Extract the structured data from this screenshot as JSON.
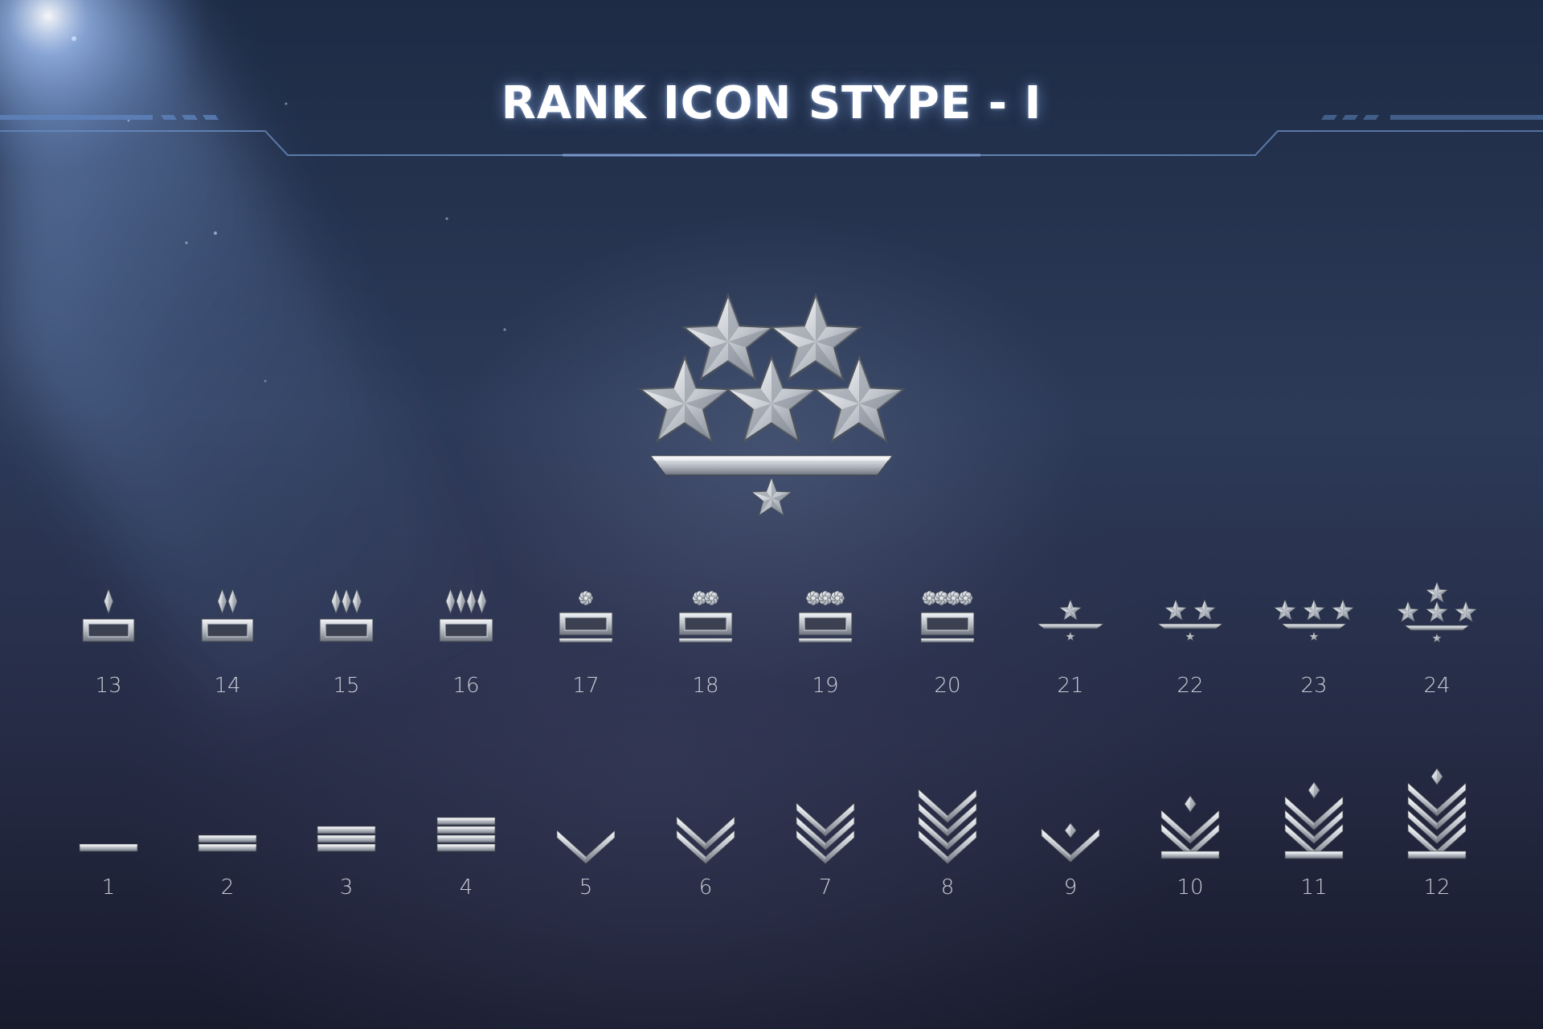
{
  "title": "RANK ICON STYPE - I",
  "colors": {
    "metal_light": "#f4f6f8",
    "metal_mid": "#b9bec6",
    "metal_dark": "#6f7580",
    "label": "#c9cdd6"
  },
  "hero": {
    "icon": "five-star-general-icon"
  },
  "top_row": [
    {
      "label": "13",
      "icon": "diamond-bar-1-icon"
    },
    {
      "label": "14",
      "icon": "diamond-bar-2-icon"
    },
    {
      "label": "15",
      "icon": "diamond-bar-3-icon"
    },
    {
      "label": "16",
      "icon": "diamond-bar-4-icon"
    },
    {
      "label": "17",
      "icon": "flower-bar-1-icon"
    },
    {
      "label": "18",
      "icon": "flower-bar-2-icon"
    },
    {
      "label": "19",
      "icon": "flower-bar-3-icon"
    },
    {
      "label": "20",
      "icon": "flower-bar-4-icon"
    },
    {
      "label": "21",
      "icon": "star-1-icon"
    },
    {
      "label": "22",
      "icon": "star-2-icon"
    },
    {
      "label": "23",
      "icon": "star-3-icon"
    },
    {
      "label": "24",
      "icon": "star-4-icon"
    }
  ],
  "bottom_row": [
    {
      "label": "1",
      "icon": "stripe-1-icon"
    },
    {
      "label": "2",
      "icon": "stripe-2-icon"
    },
    {
      "label": "3",
      "icon": "stripe-3-icon"
    },
    {
      "label": "4",
      "icon": "stripe-4-icon"
    },
    {
      "label": "5",
      "icon": "chevron-1-icon"
    },
    {
      "label": "6",
      "icon": "chevron-2-icon"
    },
    {
      "label": "7",
      "icon": "chevron-3-icon"
    },
    {
      "label": "8",
      "icon": "chevron-4-icon"
    },
    {
      "label": "9",
      "icon": "chevron-diamond-1-icon"
    },
    {
      "label": "10",
      "icon": "chevron-diamond-2-icon"
    },
    {
      "label": "11",
      "icon": "chevron-diamond-3-icon"
    },
    {
      "label": "12",
      "icon": "chevron-diamond-4-icon"
    }
  ]
}
